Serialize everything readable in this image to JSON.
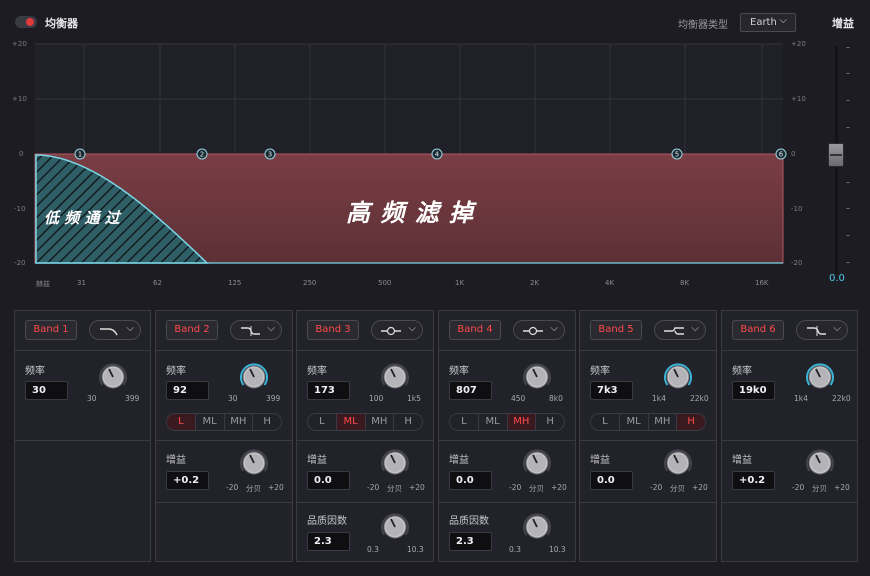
{
  "header": {
    "power_on": true,
    "eq_title": "均衡器",
    "type_label": "均衡器类型",
    "type_value": "Earth",
    "gain_title": "增益"
  },
  "graph": {
    "y_ticks_left": [
      "+20",
      "+10",
      "0",
      "-10",
      "-20"
    ],
    "y_ticks_right": [
      "+20",
      "+10",
      "0",
      "-10",
      "-20"
    ],
    "x_axis_name": "赫兹",
    "x_ticks": [
      "31",
      "62",
      "125",
      "250",
      "500",
      "1K",
      "2K",
      "4K",
      "8K",
      "16K"
    ],
    "band_markers": [
      "1",
      "2",
      "3",
      "4",
      "5",
      "6"
    ],
    "overlay_left": "低 频 通 过",
    "overlay_right": "高 频 滤 掉",
    "colors": {
      "pass_fill": "#2f5f66",
      "pass_line": "#7ad6e6",
      "cut_fill": "#6e3a40",
      "cut_line": "#b3565e"
    }
  },
  "master_gain": {
    "value": "0.0",
    "level_db": 0
  },
  "bands": [
    {
      "label": "Band 1",
      "shape": "lowpass",
      "freq": {
        "label": "频率",
        "value": "30",
        "min": "30",
        "max": "399"
      }
    },
    {
      "label": "Band 2",
      "shape": "lowshelf",
      "freq": {
        "label": "频率",
        "value": "92",
        "min": "30",
        "max": "399"
      },
      "range": {
        "options": [
          "L",
          "ML",
          "MH",
          "H"
        ],
        "selected": "L"
      },
      "gain": {
        "label": "增益",
        "value": "+0.2",
        "min": "-20",
        "mid": "分贝",
        "max": "+20"
      }
    },
    {
      "label": "Band 3",
      "shape": "bell",
      "freq": {
        "label": "频率",
        "value": "173",
        "min": "100",
        "max": "1k5"
      },
      "range": {
        "options": [
          "L",
          "ML",
          "MH",
          "H"
        ],
        "selected": "ML"
      },
      "gain": {
        "label": "增益",
        "value": "0.0",
        "min": "-20",
        "mid": "分贝",
        "max": "+20"
      },
      "q": {
        "label": "品质因数",
        "value": "2.3",
        "min": "0.3",
        "max": "10.3"
      }
    },
    {
      "label": "Band 4",
      "shape": "bell",
      "freq": {
        "label": "频率",
        "value": "807",
        "min": "450",
        "max": "8k0"
      },
      "range": {
        "options": [
          "L",
          "ML",
          "MH",
          "H"
        ],
        "selected": "MH"
      },
      "gain": {
        "label": "增益",
        "value": "0.0",
        "min": "-20",
        "mid": "分贝",
        "max": "+20"
      },
      "q": {
        "label": "品质因数",
        "value": "2.3",
        "min": "0.3",
        "max": "10.3"
      }
    },
    {
      "label": "Band 5",
      "shape": "highshelf",
      "freq": {
        "label": "频率",
        "value": "7k3",
        "min": "1k4",
        "max": "22k0"
      },
      "range": {
        "options": [
          "L",
          "ML",
          "MH",
          "H"
        ],
        "selected": "H"
      },
      "gain": {
        "label": "增益",
        "value": "0.0",
        "min": "-20",
        "mid": "分贝",
        "max": "+20"
      }
    },
    {
      "label": "Band 6",
      "shape": "highpass",
      "freq": {
        "label": "频率",
        "value": "19k0",
        "min": "1k4",
        "max": "22k0"
      },
      "gain": {
        "label": "增益",
        "value": "+0.2",
        "min": "-20",
        "mid": "分贝",
        "max": "+20"
      }
    }
  ]
}
